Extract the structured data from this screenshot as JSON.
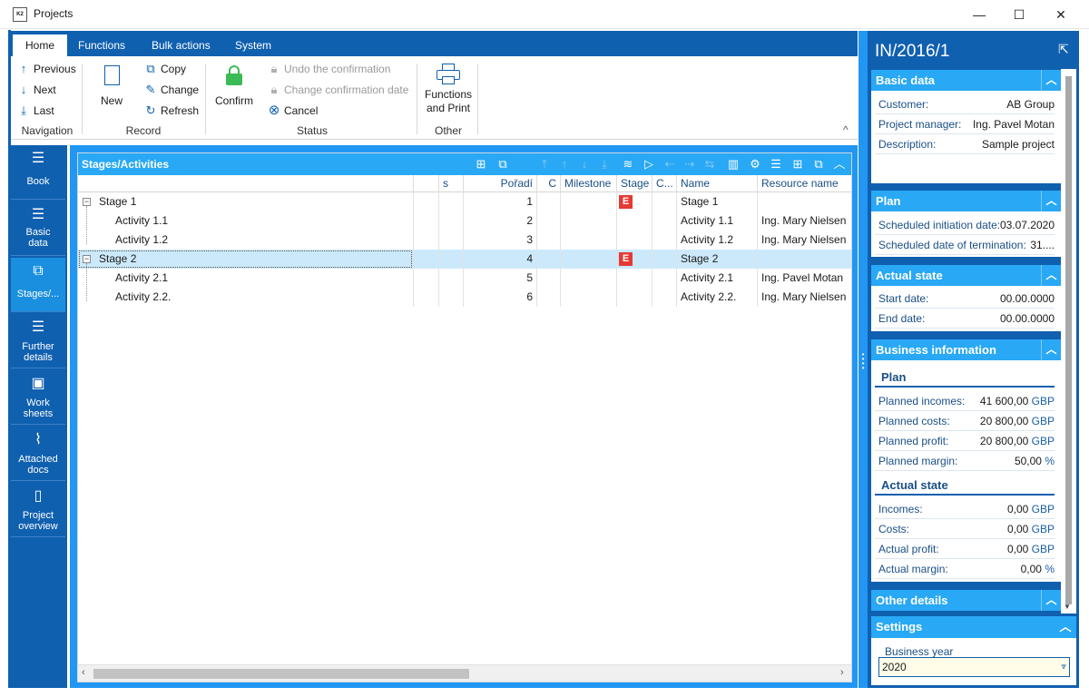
{
  "window": {
    "title": "Projects",
    "app_icon_text": "K2",
    "minimize": "—",
    "maximize": "☐",
    "close": "✕"
  },
  "ribbon": {
    "tabs": [
      "Home",
      "Functions",
      "Bulk actions",
      "System"
    ],
    "navigation": {
      "previous": "Previous",
      "next": "Next",
      "last": "Last",
      "group_label": "Navigation"
    },
    "record": {
      "new": "New",
      "copy": "Copy",
      "change": "Change",
      "refresh": "Refresh",
      "group_label": "Record"
    },
    "status": {
      "confirm": "Confirm",
      "undo_confirmation": "Undo the confirmation",
      "change_confirmation_date": "Change confirmation date",
      "cancel": "Cancel",
      "group_label": "Status"
    },
    "other": {
      "functions_print_line1": "Functions",
      "functions_print_line2": "and Print",
      "group_label": "Other"
    },
    "collapse_icon": "^"
  },
  "sidenav": [
    {
      "label1": "Book",
      "label2": "",
      "icon": "☰",
      "active": false
    },
    {
      "label1": "Basic",
      "label2": "data",
      "icon": "☰",
      "active": false
    },
    {
      "label1": "Stages/...",
      "label2": "",
      "icon": "⧉",
      "active": true
    },
    {
      "label1": "Further",
      "label2": "details",
      "icon": "☰",
      "active": false
    },
    {
      "label1": "Work",
      "label2": "sheets",
      "icon": "▣",
      "active": false
    },
    {
      "label1": "Attached",
      "label2": "docs",
      "icon": "⌇",
      "active": false
    },
    {
      "label1": "Project",
      "label2": "overview",
      "icon": "▯",
      "active": false
    }
  ],
  "grid": {
    "title": "Stages/Activities",
    "columns": {
      "s": "s",
      "order": "Pořadí",
      "c": "C",
      "milestone": "Milestone",
      "stage": "Stage",
      "c2": "C...",
      "name": "Name",
      "resource": "Resource name"
    },
    "rows": [
      {
        "tree": "Stage 1",
        "level": 0,
        "order": "1",
        "stage_badge": "E",
        "name": "Stage 1",
        "resource": "",
        "selected": false
      },
      {
        "tree": "Activity 1.1",
        "level": 1,
        "order": "2",
        "stage_badge": "",
        "name": "Activity 1.1",
        "resource": "Ing. Mary Nielsen",
        "selected": false
      },
      {
        "tree": "Activity 1.2",
        "level": 1,
        "order": "3",
        "stage_badge": "",
        "name": "Activity 1.2",
        "resource": "Ing. Mary Nielsen",
        "selected": false
      },
      {
        "tree": "Stage 2",
        "level": 0,
        "order": "4",
        "stage_badge": "E",
        "name": "Stage 2",
        "resource": "",
        "selected": true
      },
      {
        "tree": "Activity 2.1",
        "level": 1,
        "order": "5",
        "stage_badge": "",
        "name": "Activity 2.1",
        "resource": "Ing. Pavel Motan",
        "selected": false
      },
      {
        "tree": "Activity 2.2.",
        "level": 1,
        "order": "6",
        "stage_badge": "",
        "name": "Activity 2.2.",
        "resource": "Ing. Mary Nielsen",
        "selected": false
      }
    ]
  },
  "right": {
    "doc_number": "IN/2016/1",
    "basic_data": {
      "title": "Basic data",
      "customer_label": "Customer:",
      "customer": "AB Group",
      "pm_label": "Project manager:",
      "pm": "Ing. Pavel Motan",
      "desc_label": "Description:",
      "desc": "Sample project"
    },
    "plan": {
      "title": "Plan",
      "init_label": "Scheduled initiation date:",
      "init": "03.07.2020",
      "term_label": "Scheduled date of termination:",
      "term": "31...."
    },
    "actual_state": {
      "title": "Actual state",
      "start_label": "Start date:",
      "start": "00.00.0000",
      "end_label": "End date:",
      "end": "00.00.0000"
    },
    "business": {
      "title": "Business information",
      "plan_title": "Plan",
      "planned_incomes_label": "Planned incomes:",
      "planned_incomes": "41 600,00",
      "planned_costs_label": "Planned costs:",
      "planned_costs": "20 800,00",
      "planned_profit_label": "Planned profit:",
      "planned_profit": "20 800,00",
      "planned_margin_label": "Planned margin:",
      "planned_margin": "50,00",
      "actual_title": "Actual state",
      "incomes_label": "Incomes:",
      "incomes": "0,00",
      "costs_label": "Costs:",
      "costs": "0,00",
      "actual_profit_label": "Actual profit:",
      "actual_profit": "0,00",
      "actual_margin_label": "Actual margin:",
      "actual_margin": "0,00",
      "currency": "GBP",
      "percent": "%"
    },
    "other_details": {
      "title": "Other details"
    },
    "settings": {
      "title": "Settings",
      "business_year_label": "Business year",
      "business_year": "2020"
    }
  }
}
